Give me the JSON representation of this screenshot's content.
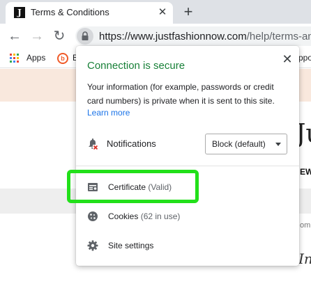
{
  "tab": {
    "favicon": "J",
    "title": "Terms & Conditions",
    "close_glyph": "✕",
    "new_tab_glyph": "+"
  },
  "toolbar": {
    "back_glyph": "←",
    "forward_glyph": "→",
    "reload_glyph": "↻",
    "url_host": "https://www.justfashionnow.com",
    "url_path": "/help/terms-and"
  },
  "bookmarks": {
    "apps_label": "Apps",
    "item_icon_letter": "b",
    "item_label": "B",
    "right_fragment": "ppo"
  },
  "page": {
    "logo_fragment": "Ju",
    "nav_fragment": "EW",
    "small_fragment": "om",
    "script_fragment": "In"
  },
  "popup": {
    "title": "Connection is secure",
    "description": "Your information (for example, passwords or credit card numbers) is private when it is sent to this site.",
    "learn_more": "Learn more",
    "close_glyph": "✕",
    "notifications": {
      "label": "Notifications",
      "selected": "Block (default)"
    },
    "certificate": {
      "label": "Certificate",
      "status": "(Valid)"
    },
    "cookies": {
      "label": "Cookies",
      "status": "(62 in use)"
    },
    "site_settings": {
      "label": "Site settings"
    }
  },
  "colors": {
    "secure_green": "#188038",
    "link_blue": "#1a73e8",
    "highlight_green": "#22e01a",
    "page_band": "#f9e8dd"
  }
}
